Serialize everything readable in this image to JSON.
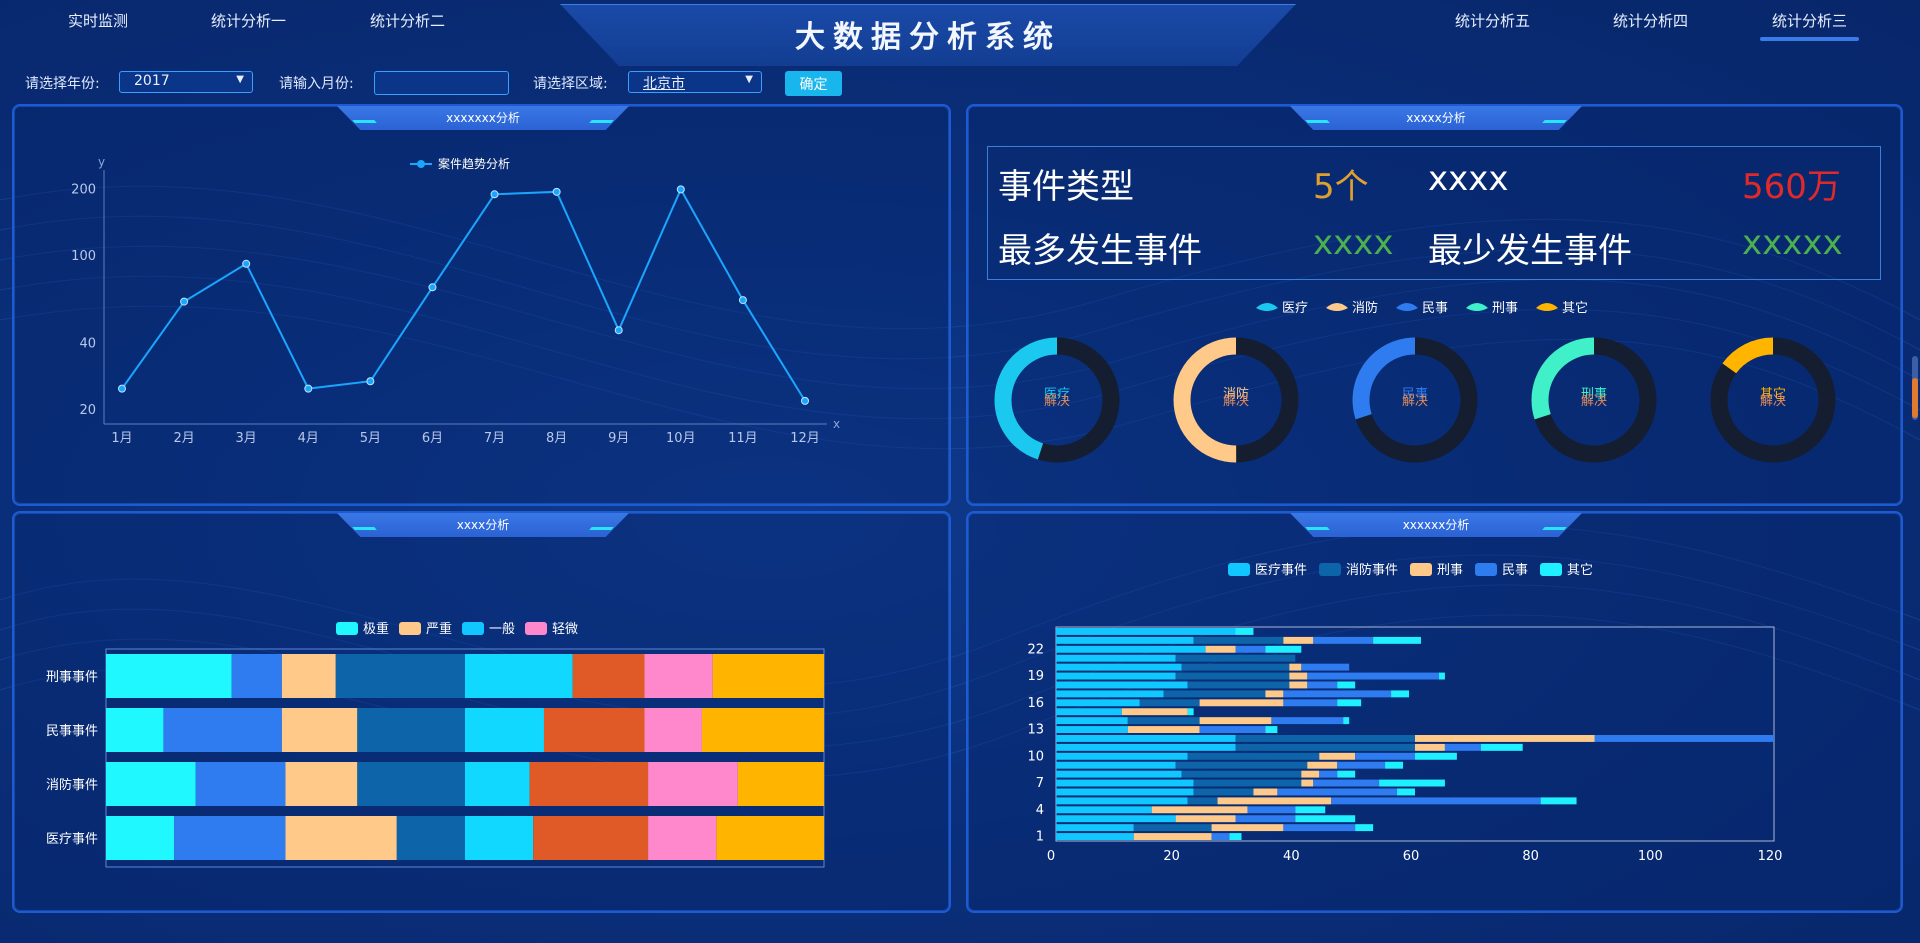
{
  "header": {
    "title": "大数据分析系统",
    "nav_left": [
      "实时监测",
      "统计分析一",
      "统计分析二"
    ],
    "nav_right": [
      "统计分析五",
      "统计分析四",
      "统计分析三"
    ],
    "active_nav": "统计分析三"
  },
  "filters": {
    "year_label": "请选择年份:",
    "year_value": "2017",
    "month_label": "请输入月份:",
    "month_value": "",
    "region_label": "请选择区域:",
    "region_value": "北京市",
    "confirm_label": "确定"
  },
  "panels": {
    "line": {
      "title": "xxxxxxx分析"
    },
    "stats": {
      "title": "xxxxx分析"
    },
    "stacked": {
      "title": "xxxx分析"
    },
    "hbar": {
      "title": "xxxxxx分析"
    }
  },
  "stats": {
    "row1_label1": "事件类型",
    "row1_value1": "5个",
    "row1_label2": "xxxx",
    "row1_value2": "560万",
    "row2_label1": "最多发生事件",
    "row2_value1": "xxxx",
    "row2_label2": "最少发生事件",
    "row2_value2": "xxxxx",
    "colors": {
      "orange": "#e0a030",
      "green": "#4caf50",
      "red": "#e02a2a"
    }
  },
  "chart_data": [
    {
      "type": "line",
      "title": "",
      "legend": [
        "案件趋势分析"
      ],
      "xlabel": "x",
      "ylabel": "y",
      "y_scale": "log",
      "y_ticks": [
        20,
        40,
        100,
        200
      ],
      "categories": [
        "1月",
        "2月",
        "3月",
        "4月",
        "5月",
        "6月",
        "7月",
        "8月",
        "9月",
        "10月",
        "11月",
        "12月"
      ],
      "series": [
        {
          "name": "案件趋势分析",
          "values": [
            25,
            62,
            92,
            25,
            27,
            72,
            190,
            195,
            46,
            200,
            63,
            22
          ]
        }
      ]
    },
    {
      "type": "pie",
      "title": "",
      "legend": [
        "医疗",
        "消防",
        "民事",
        "刑事",
        "其它"
      ],
      "series": [
        {
          "name": "医疗",
          "center_label": "医疗",
          "sub_label": "解决",
          "value": 45,
          "color": "#1ac8f0"
        },
        {
          "name": "消防",
          "center_label": "消防",
          "sub_label": "解决",
          "value": 50,
          "color": "#ffc98a"
        },
        {
          "name": "民事",
          "center_label": "民事",
          "sub_label": "解决",
          "value": 30,
          "color": "#2f7bf0"
        },
        {
          "name": "刑事",
          "center_label": "刑事",
          "sub_label": "解决",
          "value": 30,
          "color": "#3ff0c8"
        },
        {
          "name": "其它",
          "center_label": "其它",
          "sub_label": "解决",
          "value": 15,
          "color": "#ffb400"
        }
      ]
    },
    {
      "type": "bar",
      "title": "",
      "orientation": "horizontal",
      "stacked": "percent",
      "legend": [
        "极重",
        "严重",
        "一般",
        "轻微"
      ],
      "categories": [
        "刑事事件",
        "民事事件",
        "消防事件",
        "医疗事件"
      ],
      "groups": [
        "A",
        "B"
      ],
      "note": "each row split into two halves; each half stacked by severity",
      "series": [
        {
          "name": "极重",
          "values_a": [
            35,
            16,
            25,
            19
          ],
          "values_b": [
            30,
            22,
            18,
            19
          ],
          "color": "#1ff8ff"
        },
        {
          "name": "严重",
          "values_a": [
            14,
            33,
            25,
            31
          ],
          "values_b": [
            20,
            28,
            33,
            32
          ],
          "color": "#2f7bf0"
        },
        {
          "name": "一般",
          "values_a": [
            15,
            21,
            20,
            31
          ],
          "values_b": [
            19,
            16,
            25,
            19
          ],
          "color": "#ffc98a"
        },
        {
          "name": "轻微",
          "values_a": [
            36,
            30,
            30,
            19
          ],
          "values_b": [
            31,
            34,
            24,
            30
          ],
          "color": "#0d64a8"
        }
      ],
      "colors_b": [
        "#10d8ff",
        "#e05a28",
        "#ff88cc",
        "#ffb400"
      ]
    },
    {
      "type": "bar",
      "title": "",
      "orientation": "horizontal",
      "stacked": true,
      "legend": [
        "医疗事件",
        "消防事件",
        "刑事",
        "民事",
        "其它"
      ],
      "y_ticks": [
        1,
        4,
        7,
        10,
        13,
        16,
        19,
        22
      ],
      "x_ticks": [
        0,
        20,
        40,
        60,
        80,
        100,
        120
      ],
      "xlim": [
        0,
        120
      ],
      "categories": [
        "1",
        "2",
        "3",
        "4",
        "5",
        "6",
        "7",
        "8",
        "9",
        "10",
        "11",
        "12",
        "13",
        "14",
        "15",
        "16",
        "17",
        "18",
        "19",
        "20",
        "21",
        "22",
        "23",
        "24"
      ],
      "series": [
        {
          "name": "医疗事件",
          "color": "#10c8ff",
          "values": [
            13,
            13,
            20,
            16,
            22,
            23,
            23,
            21,
            20,
            22,
            30,
            30,
            12,
            12,
            11,
            14,
            18,
            22,
            20,
            21,
            20,
            25,
            23,
            30
          ]
        },
        {
          "name": "消防事件",
          "color": "#0d64a8",
          "values": [
            0,
            13,
            0,
            0,
            5,
            10,
            18,
            20,
            22,
            22,
            30,
            30,
            0,
            12,
            0,
            10,
            17,
            17,
            19,
            18,
            20,
            0,
            15,
            0
          ]
        },
        {
          "name": "刑事",
          "color": "#ffc98a",
          "values": [
            13,
            12,
            10,
            16,
            19,
            4,
            2,
            3,
            5,
            6,
            5,
            30,
            12,
            12,
            11,
            14,
            3,
            3,
            3,
            2,
            0,
            5,
            5,
            0
          ]
        },
        {
          "name": "民事",
          "color": "#2f7bf0",
          "values": [
            3,
            12,
            10,
            8,
            35,
            20,
            11,
            3,
            8,
            10,
            6,
            30,
            11,
            12,
            0,
            9,
            18,
            5,
            22,
            8,
            0,
            5,
            10,
            0
          ]
        },
        {
          "name": "其它",
          "color": "#1ff0ff",
          "values": [
            2,
            3,
            10,
            5,
            6,
            3,
            11,
            3,
            3,
            7,
            7,
            0,
            2,
            1,
            1,
            4,
            3,
            3,
            1,
            0,
            0,
            6,
            8,
            3
          ]
        }
      ]
    }
  ]
}
